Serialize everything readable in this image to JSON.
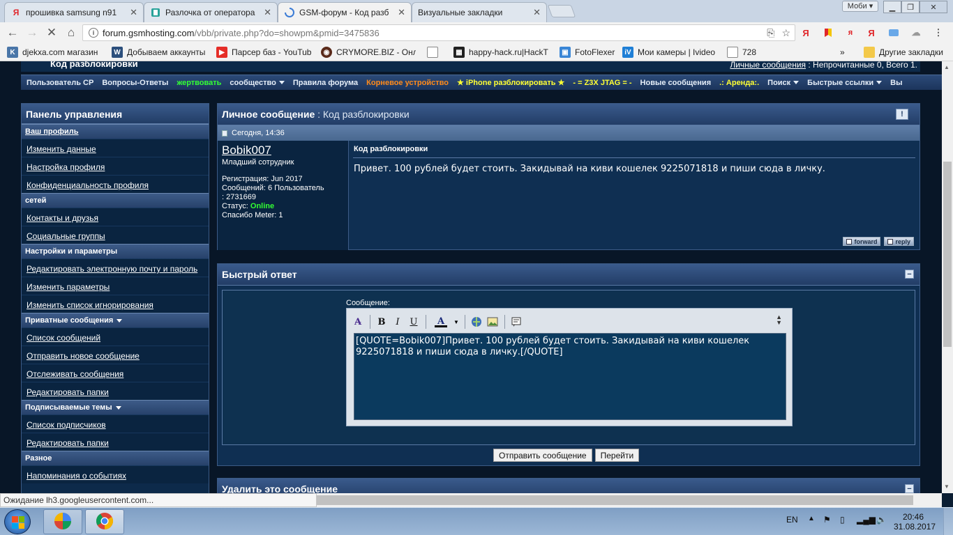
{
  "browser": {
    "tabs": [
      {
        "title": "прошивка samsung n91",
        "favicon": "yandex-icon",
        "active": false
      },
      {
        "title": "Разлочка от оператора",
        "favicon": "forum-icon",
        "active": false
      },
      {
        "title": "GSM-форум - Код разб",
        "favicon": "loading-icon",
        "active": true
      },
      {
        "title": "Визуальные закладки",
        "favicon": "none",
        "active": false
      }
    ],
    "profile_label": "Моби",
    "url_host": "forum.gsmhosting.com",
    "url_path": "/vbb/private.php?do=showpm&pmid=3475836",
    "bookmarks": [
      {
        "label": "djekxa.com магазин",
        "icon": "vk-icon"
      },
      {
        "label": "Добываем аккаунты",
        "icon": "site-icon"
      },
      {
        "label": "Парсер баз - YouTub",
        "icon": "youtube-icon"
      },
      {
        "label": "CRYMORE.BIZ - Онла",
        "icon": "crymore-icon"
      },
      {
        "label": "",
        "icon": "page-icon"
      },
      {
        "label": "happy-hack.ru|HackT",
        "icon": "hack-icon"
      },
      {
        "label": "FotoFlexer",
        "icon": "fotoflexer-icon"
      },
      {
        "label": "Мои камеры | Ivideo",
        "icon": "ivideon-icon"
      },
      {
        "label": "728",
        "icon": "page-icon"
      }
    ],
    "other_bookmarks": "Другие закладки",
    "more": "»"
  },
  "forum": {
    "header_left": "Код разблокировки",
    "header_right_link": "Личные сообщения",
    "header_right_text": ": Непрочитанные 0, Всего 1.",
    "nav": [
      {
        "label": "Пользователь CP",
        "color": "#e6eef8",
        "dropdown": false
      },
      {
        "label": "Вопросы-Ответы",
        "color": "#e6eef8",
        "dropdown": false
      },
      {
        "label": "жертвовать",
        "color": "#33ff33",
        "dropdown": false
      },
      {
        "label": "сообщество",
        "color": "#e6eef8",
        "dropdown": true
      },
      {
        "label": "Правила форума",
        "color": "#e6eef8",
        "dropdown": false
      },
      {
        "label": "Корневое устройство",
        "color": "#ff8a1a",
        "dropdown": false
      },
      {
        "label": "★ iPhone разблокировать ★",
        "color": "#ffff33",
        "dropdown": false
      },
      {
        "label": "- = Z3X JTAG = -",
        "color": "#ffff33",
        "dropdown": false
      },
      {
        "label": "Новые сообщения",
        "color": "#e6eef8",
        "dropdown": false
      },
      {
        "label": ".: Аренда:.",
        "color": "#ffff33",
        "dropdown": false
      },
      {
        "label": "Поиск",
        "color": "#e6eef8",
        "dropdown": true
      },
      {
        "label": "Быстрые ссылки",
        "color": "#e6eef8",
        "dropdown": true
      },
      {
        "label": "Вы",
        "color": "#e6eef8",
        "dropdown": false
      }
    ]
  },
  "sidebar": {
    "title": "Панель управления",
    "sections": [
      {
        "title": "Ваш профиль",
        "underline": true,
        "dropdown": false,
        "items": [
          "Изменить данные",
          "Настройка профиля",
          "Конфиденциальность профиля"
        ]
      },
      {
        "title": "сетей",
        "underline": false,
        "dropdown": false,
        "items": [
          "Контакты и друзья",
          "Социальные группы"
        ]
      },
      {
        "title": "Настройки и параметры",
        "underline": false,
        "dropdown": false,
        "items": [
          "Редактировать электронную почту и пароль",
          "Изменить параметры",
          "Изменить список игнорирования"
        ]
      },
      {
        "title": "Приватные сообщения",
        "underline": false,
        "dropdown": true,
        "items": [
          "Список сообщений",
          "Отправить новое сообщение",
          "Отслеживать сообщения",
          "Редактировать папки"
        ]
      },
      {
        "title": "Подписываемые темы",
        "underline": false,
        "dropdown": true,
        "items": [
          "Список подписчиков",
          "Редактировать папки"
        ]
      },
      {
        "title": "Разное",
        "underline": false,
        "dropdown": false,
        "items": [
          "Напоминания о событиях"
        ]
      }
    ]
  },
  "message": {
    "header_label": "Личное сообщение",
    "header_subject": ": Код разблокировки",
    "date": "Сегодня, 14:36",
    "author": {
      "name": "Bobik007",
      "rank": "Младший сотрудник",
      "stat_reg": "Регистрация: Jun 2017",
      "stat_posts": "Сообщений: 6 Пользователь",
      "stat_id": ": 2731669",
      "status_label": "Статус: ",
      "status_value": "Online",
      "thanks": "Спасибо Meter: 1"
    },
    "title": "Код разблокировки",
    "text": "Привет. 100 рублей будет стоить. Закидывай на киви кошелек 9225071818 и пиши сюда в личку.",
    "forward_label": "forward",
    "reply_label": "reply"
  },
  "quick_reply": {
    "title": "Быстрый ответ",
    "label": "Сообщение:",
    "value": "[QUOTE=Bobik007]Привет. 100 рублей будет стоить. Закидывай на киви кошелек 9225071818 и пиши сюда в личку.[/QUOTE]",
    "submit_label": "Отправить сообщение",
    "go_label": "Перейти"
  },
  "delete_panel": {
    "title": "Удалить это сообщение"
  },
  "status_text": "Ожидание lh3.googleusercontent.com...",
  "taskbar": {
    "lang": "EN",
    "time": "20:46",
    "date": "31.08.2017"
  }
}
